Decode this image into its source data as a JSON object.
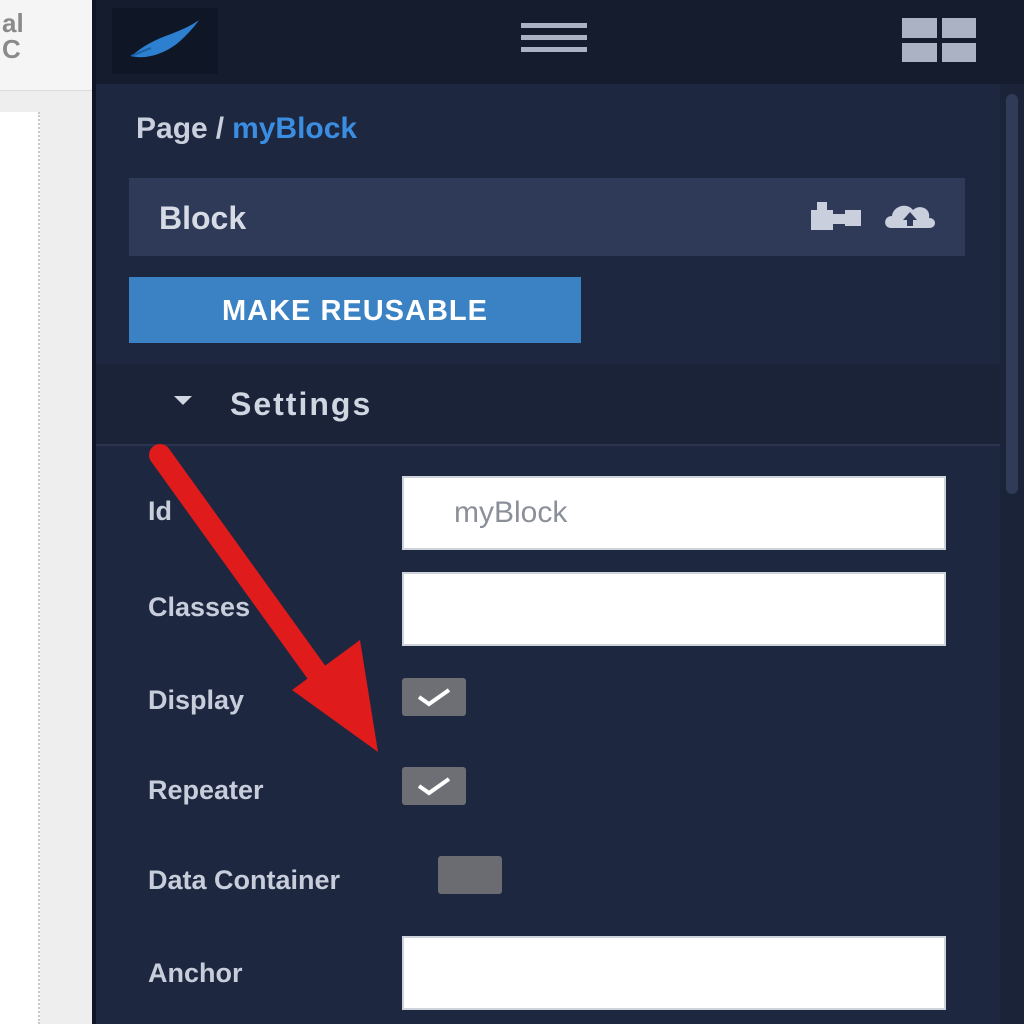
{
  "left_panel": {
    "top_fragment": "al\nC"
  },
  "topbar": {
    "logo_icon": "quill-icon",
    "menu_icon": "hamburger-menu-icon",
    "grid_icon": "grid-layout-icon"
  },
  "breadcrumb": {
    "root": "Page",
    "separator": "/",
    "current": "myBlock"
  },
  "block": {
    "title": "Block",
    "icons": [
      "puzzle-icon",
      "cloud-upload-icon"
    ]
  },
  "make_reusable_label": "MAKE REUSABLE",
  "settings": {
    "label": "Settings",
    "fields": {
      "id_label": "Id",
      "id_value": "myBlock",
      "classes_label": "Classes",
      "classes_value": "",
      "display_label": "Display",
      "display_checked": true,
      "repeater_label": "Repeater",
      "repeater_checked": true,
      "data_container_label": "Data Container",
      "data_container_checked": false,
      "anchor_label": "Anchor",
      "anchor_value": ""
    }
  },
  "colors": {
    "panel_bg": "#1d2740",
    "accent": "#3a82c4",
    "link": "#3a8de0",
    "annotation_arrow": "#e01b1b"
  }
}
